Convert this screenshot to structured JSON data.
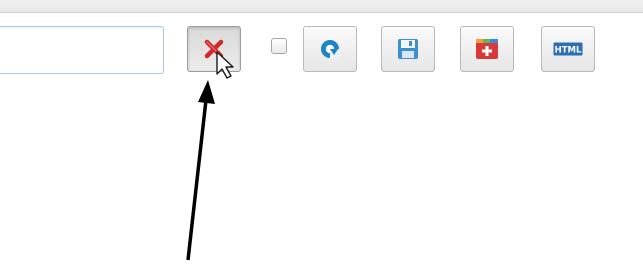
{
  "toolbar": {
    "search": {
      "value": "",
      "placeholder": ""
    },
    "buttons": [
      {
        "icon": "red-x-icon",
        "pressed": true
      },
      {
        "icon": "refresh-icon"
      },
      {
        "icon": "floppy-disk-icon"
      },
      {
        "icon": "add-icon"
      },
      {
        "icon": "html-icon",
        "text": "HTML"
      }
    ]
  },
  "colors": {
    "red": "#d12a2a",
    "blue": "#1e84c8",
    "input_border": "#a9c7e6"
  }
}
